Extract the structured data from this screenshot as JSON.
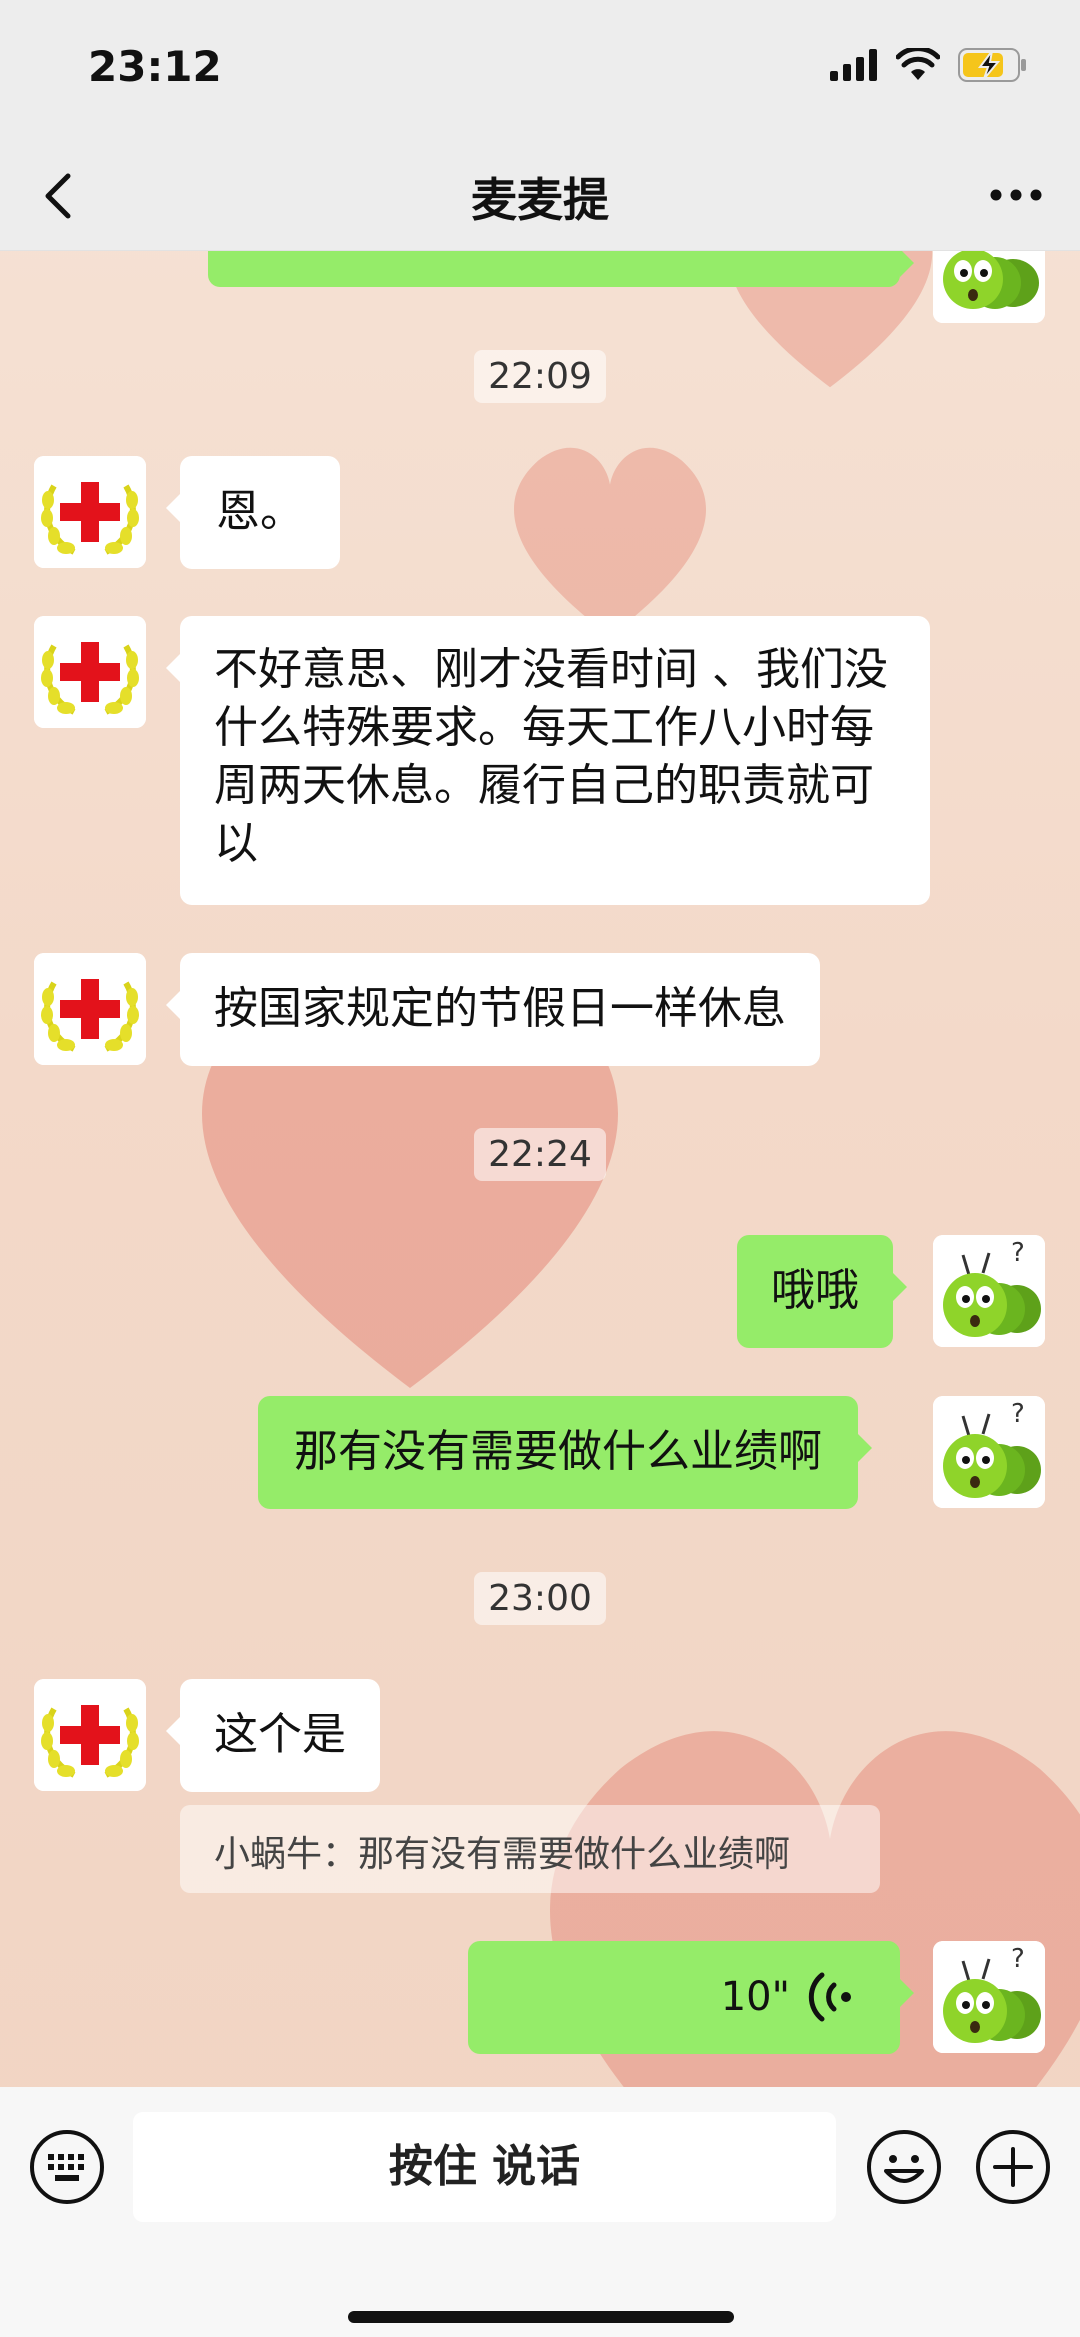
{
  "status_bar": {
    "time": "23:12",
    "battery_state": "charging"
  },
  "nav": {
    "title": "麦麦提",
    "back_icon": "chevron-left-icon",
    "more_icon": "more-dots-icon"
  },
  "messages": {
    "m0_partial": "",
    "ts1": "22:09",
    "m1": "恩。",
    "m2": "不好意思、刚才没看时间 、我们没什么特殊要求。每天工作八小时每周两天休息。履行自己的职责就可以",
    "m3": "按国家规定的节假日一样休息",
    "ts2": "22:24",
    "m4": "哦哦",
    "m5": "那有没有需要做什么业绩啊",
    "ts3": "23:00",
    "m6": "这个是",
    "quote": "小蜗牛：那有没有需要做什么业绩啊",
    "voice": "10\""
  },
  "input_bar": {
    "talk_label": "按住 说话",
    "keyboard_icon": "keyboard-icon",
    "emoji_icon": "emoji-icon",
    "plus_icon": "plus-icon"
  },
  "colors": {
    "bubble_self": "#95ec69",
    "bubble_other": "#ffffff",
    "bar": "#ededed"
  }
}
